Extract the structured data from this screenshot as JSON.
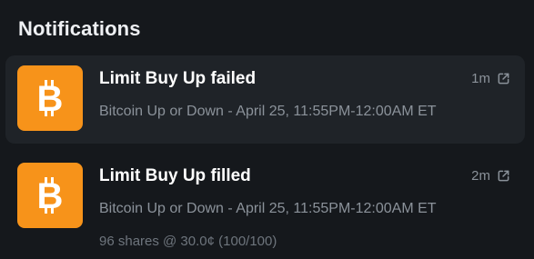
{
  "panel": {
    "title": "Notifications"
  },
  "notifications": [
    {
      "title": "Limit Buy Up failed",
      "time": "1m",
      "market": "Bitcoin Up or Down - April 25, 11:55PM-12:00AM ET",
      "icon": "bitcoin-icon",
      "highlighted": true
    },
    {
      "title": "Limit Buy Up filled",
      "time": "2m",
      "market": "Bitcoin Up or Down - April 25, 11:55PM-12:00AM ET",
      "detail": "96 shares @ 30.0¢ (100/100)",
      "icon": "bitcoin-icon",
      "highlighted": false
    }
  ],
  "colors": {
    "background": "#15181c",
    "highlight": "#1f2328",
    "bitcoin": "#f7931a",
    "muted_text": "#8b929a"
  }
}
